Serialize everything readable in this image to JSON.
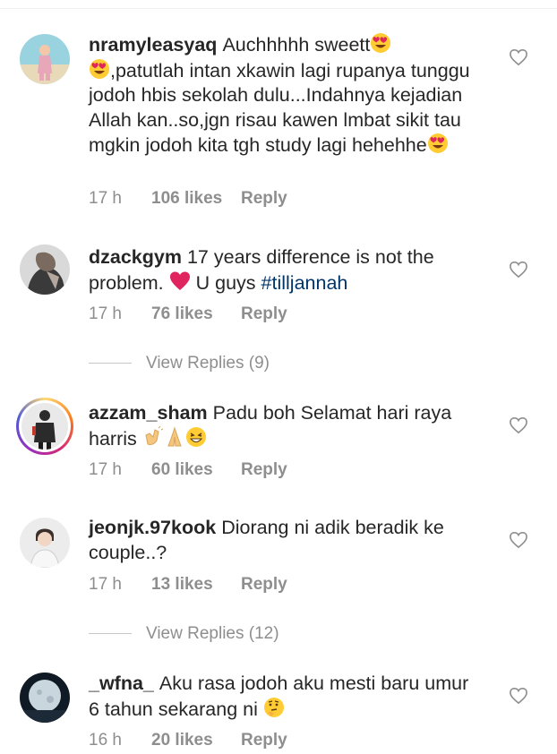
{
  "comments": [
    {
      "username": "nramyleasyaq",
      "text_parts": [
        "Auchhhhh sweett",
        ",patutlah intan xkawin lagi rupanya tunggu jodoh hbis sekolah dulu...Indahnya kejadian Allah kan..so,jgn risau kawen lmbat sikit tau mgkin jodoh kita tgh study lagi hehehhe"
      ],
      "emojis": [
        "heart-eyes",
        "heart-eyes",
        "heart-eyes"
      ],
      "time": "17 h",
      "likes": "106 likes",
      "reply": "Reply"
    },
    {
      "username": "dzackgym",
      "text_parts": [
        "17 years difference is not the problem.",
        "U guys"
      ],
      "hashtag": "#tilljannah",
      "emojis": [
        "red-heart"
      ],
      "time": "17 h",
      "likes": "76 likes",
      "reply": "Reply"
    },
    {
      "username": "azzam_sham",
      "text_parts": [
        "Padu boh Selamat hari raya harris"
      ],
      "emojis": [
        "clapping-hands",
        "folded-hands",
        "grinning-squinting"
      ],
      "time": "17 h",
      "likes": "60 likes",
      "reply": "Reply"
    },
    {
      "username": "jeonjk.97kook",
      "text_parts": [
        "Diorang ni adik beradik ke couple..?"
      ],
      "emojis": [],
      "time": "17 h",
      "likes": "13 likes",
      "reply": "Reply"
    },
    {
      "username": "_wfna_",
      "text_parts": [
        "Aku rasa jodoh aku mesti baru umur 6 tahun sekarang ni"
      ],
      "emojis": [
        "thinking-face"
      ],
      "time": "16 h",
      "likes": "20 likes",
      "reply": "Reply"
    }
  ],
  "view_replies": [
    "View Replies (9)",
    "View Replies (12)"
  ],
  "colors": {
    "text": "#262626",
    "muted": "#8e8e8e",
    "hashtag": "#003569",
    "heart": "#ed4956"
  }
}
